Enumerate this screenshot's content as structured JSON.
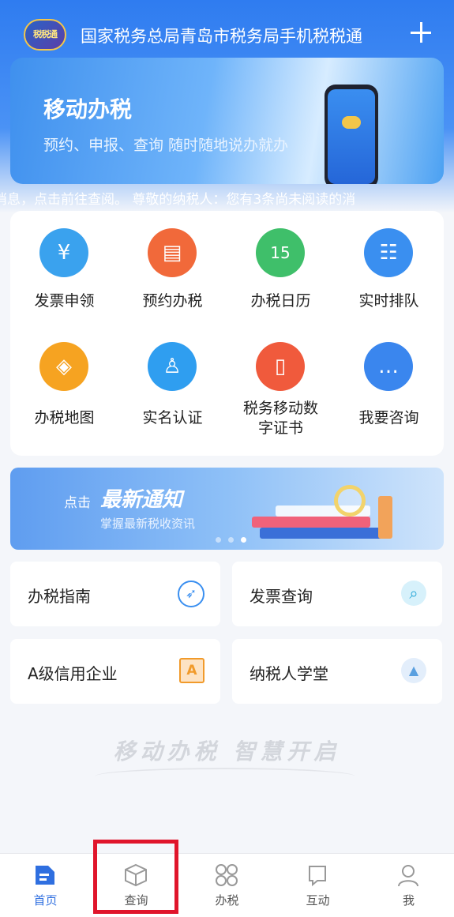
{
  "header": {
    "logo_text": "税税通",
    "title": "国家税务总局青岛市税务局手机税税通"
  },
  "banner": {
    "title": "移动办税",
    "subtitle": "预约、申报、查询 随时随地说办就办"
  },
  "ticker": {
    "text": "消息，点击前往查阅。   尊敬的纳税人：您有3条尚未阅读的消"
  },
  "services": [
    {
      "label": "发票申领",
      "icon": "invoice-icon",
      "color": "#3aa2ee",
      "glyph": "¥"
    },
    {
      "label": "预约办税",
      "icon": "appointment-icon",
      "color": "#f1693a",
      "glyph": "▤"
    },
    {
      "label": "办税日历",
      "icon": "calendar-icon",
      "color": "#3fbf6a",
      "glyph": "15"
    },
    {
      "label": "实时排队",
      "icon": "queue-icon",
      "color": "#3a8ff0",
      "glyph": "☷"
    },
    {
      "label": "办税地图",
      "icon": "map-icon",
      "color": "#f6a321",
      "glyph": "◈"
    },
    {
      "label": "实名认证",
      "icon": "user-verify-icon",
      "color": "#2f9ef0",
      "glyph": "♙"
    },
    {
      "label": "税务移动数字证书",
      "icon": "certificate-icon",
      "color": "#f05a3c",
      "glyph": "▯"
    },
    {
      "label": "我要咨询",
      "icon": "chat-icon",
      "color": "#3a86ee",
      "glyph": "…"
    }
  ],
  "notice": {
    "click_text": "点击",
    "title": "最新通知",
    "description": "掌握最新税收资讯"
  },
  "quick_links": [
    {
      "label": "办税指南",
      "icon": "compass-icon",
      "glyph": "⊘",
      "color": "#3a8ff0"
    },
    {
      "label": "发票查询",
      "icon": "magnifier-icon",
      "glyph": "⌕",
      "color": "#2aa8d8"
    },
    {
      "label": "A级信用企业",
      "icon": "a-badge-icon",
      "glyph": "A",
      "color": "#f19a2a"
    },
    {
      "label": "纳税人学堂",
      "icon": "graduation-cap-icon",
      "glyph": "🎓",
      "color": "#5aa0e0"
    }
  ],
  "slogan": "移动办税 智慧开启",
  "tabs": [
    {
      "label": "首页",
      "icon": "home-icon"
    },
    {
      "label": "查询",
      "icon": "box-icon"
    },
    {
      "label": "办税",
      "icon": "grid-icon"
    },
    {
      "label": "互动",
      "icon": "interact-icon"
    },
    {
      "label": "我",
      "icon": "person-icon"
    }
  ]
}
